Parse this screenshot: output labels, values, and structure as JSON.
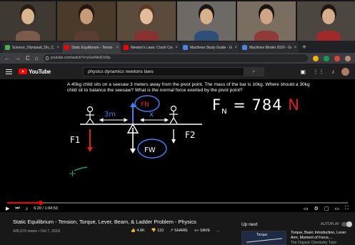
{
  "meeting": {
    "participants": [
      {
        "bg": "#3e3a33",
        "skin": "#d9b48f",
        "hair": "#2a1d12",
        "shirt": "#7a5a48",
        "active": false
      },
      {
        "bg": "#4a3a2a",
        "skin": "#c79a78",
        "hair": "#231710",
        "shirt": "#5c3d33",
        "active": true
      },
      {
        "bg": "#5a4b3c",
        "skin": "#e3bc9b",
        "hair": "#5b3a22",
        "shirt": "#8a3030",
        "active": false
      },
      {
        "bg": "#6d6a66",
        "skin": "#d7b08c",
        "hair": "#1b1612",
        "shirt": "#2d4f7a",
        "active": false
      },
      {
        "bg": "#7a6e60",
        "skin": "#cfa684",
        "hair": "#1a1410",
        "shirt": "#913a37",
        "active": false
      },
      {
        "bg": "#4c4640",
        "skin": "#d4ad8b",
        "hair": "#1d1611",
        "shirt": "#a02a2a",
        "active": false
      }
    ]
  },
  "browser": {
    "tabs": [
      {
        "title": "Science_Olympiad_Div_C_2",
        "color": "#4caf50",
        "active": false
      },
      {
        "title": "Static Equilibrium - Tensio",
        "color": "#ff0000",
        "active": true
      },
      {
        "title": "Newton's Laws: Crash Cou",
        "color": "#ff0000",
        "active": false
      },
      {
        "title": "Machines Study Guide - Go",
        "color": "#4a86e8",
        "active": false
      },
      {
        "title": "Machines Binder 2020 - Go",
        "color": "#4a86e8",
        "active": false
      }
    ],
    "new_tab": "+",
    "url": "youtube.com/watch?v=yGeRAdOcRjo",
    "back": "←",
    "forward": "→",
    "reload": "C",
    "home": "⌂"
  },
  "youtube": {
    "logo": "YouTube",
    "search_query": "physics dynamics newtons laws",
    "search_icon": "search-icon",
    "header_icons": [
      "create-icon",
      "apps-icon",
      "bell-icon"
    ]
  },
  "video": {
    "problem_text": "A 40kg child sits on a seesaw 3 meters away from the pivot point.  The mass of the bar is 10kg.  Where should a 30kg child sit to balance the seesaw?  What is the normal force exerted by the pivot point?",
    "handwriting": {
      "fn_equation": "FN = 784",
      "fn_prefix": "F",
      "fn_sub": "N",
      "fn_eq": " = 784 ",
      "unit": "N",
      "dist_label": "3m",
      "x_label": "x",
      "fn_circle": "FN",
      "fw_circle": "FW",
      "f1": "F1",
      "f2": "F2",
      "torque_sign_plus": "+",
      "torque_sign_minus": "-"
    },
    "time_current": "6:20",
    "time_total": "1:04:53",
    "progress": 0.098,
    "volume_icon": "volume-icon"
  },
  "details": {
    "title": "Static Equilibrium - Tension, Torque, Lever, Beam, & Ladder Problem - Physics",
    "views_date": "426,570 views • Oct 7, 2016",
    "likes": "4.6K",
    "dislikes": "110",
    "share": "SHARE",
    "save": "SAVE",
    "more": "...",
    "up_next": "Up next",
    "autoplay": "AUTOPLAY",
    "next_thumb_label": "Torque",
    "next_title": "Torque, Basic Introduction, Lever Arm, Moment of Force,...",
    "next_channel": "The Organic Chemistry Tutor"
  }
}
